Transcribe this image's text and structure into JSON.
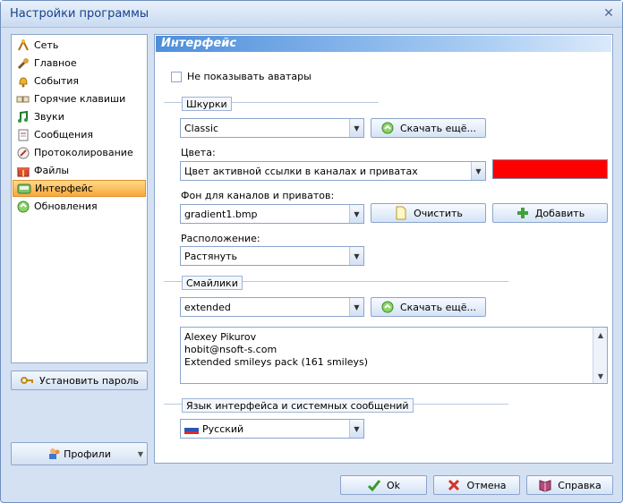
{
  "window": {
    "title": "Настройки программы",
    "close_glyph": "✕"
  },
  "sidebar": {
    "items": [
      {
        "label": "Сеть",
        "icon": "network-icon"
      },
      {
        "label": "Главное",
        "icon": "wrench-icon"
      },
      {
        "label": "События",
        "icon": "bell-icon"
      },
      {
        "label": "Горячие клавиши",
        "icon": "keys-icon"
      },
      {
        "label": "Звуки",
        "icon": "music-note-icon"
      },
      {
        "label": "Сообщения",
        "icon": "message-icon"
      },
      {
        "label": "Протоколирование",
        "icon": "log-icon"
      },
      {
        "label": "Файлы",
        "icon": "gift-icon"
      },
      {
        "label": "Интерфейс",
        "icon": "interface-icon",
        "active": true
      },
      {
        "label": "Обновления",
        "icon": "update-icon"
      }
    ],
    "set_password_label": "Установить пароль",
    "profiles_label": "Профили"
  },
  "interface": {
    "header": "Интерфейс",
    "hide_avatars_label": "Не показывать аватары",
    "skins_group": "Шкурки",
    "skin_value": "Classic",
    "download_more_label": "Скачать ещё...",
    "colors_label": "Цвета:",
    "color_target_value": "Цвет активной ссылки в каналах и приватах",
    "color_value": "#ff0000",
    "background_label": "Фон для каналов и приватов:",
    "background_value": "gradient1.bmp",
    "clear_label": "Очистить",
    "add_label": "Добавить",
    "position_label": "Расположение:",
    "position_value": "Растянуть",
    "smileys_group": "Смайлики",
    "smileys_value": "extended",
    "smileys_download_label": "Скачать ещё...",
    "smileys_info": [
      "Alexey Pikurov",
      "hobit@nsoft-s.com",
      "Extended smileys pack (161 smileys)"
    ],
    "language_group": "Язык интерфейса и системных сообщений",
    "language_value": "Русский"
  },
  "footer": {
    "ok_label": "Ok",
    "cancel_label": "Отмена",
    "help_label": "Справка"
  }
}
